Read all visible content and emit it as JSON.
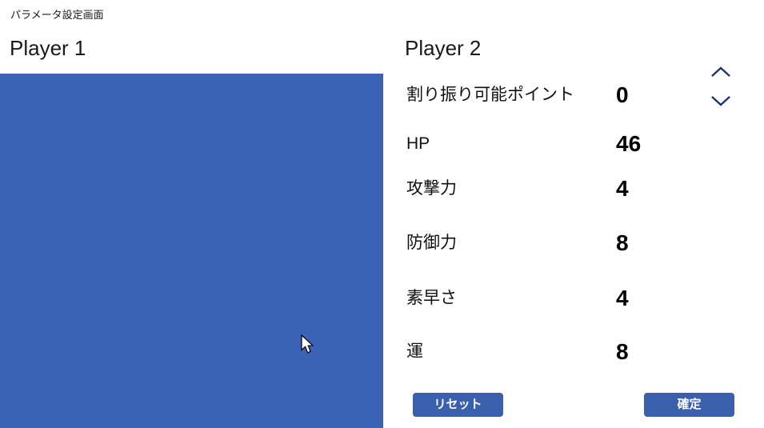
{
  "window": {
    "title": "パラメータ設定画面"
  },
  "player1": {
    "heading": "Player 1",
    "panel_color": "#3a62b5"
  },
  "player2": {
    "heading": "Player 2",
    "stats": [
      {
        "label": "割り振り可能ポイント",
        "value": "0",
        "has_spinner": false
      },
      {
        "label": "HP",
        "value": "46",
        "has_spinner": false
      },
      {
        "label": "攻撃力",
        "value": "4",
        "has_spinner": true
      },
      {
        "label": "防御力",
        "value": "8",
        "has_spinner": true
      },
      {
        "label": "素早さ",
        "value": "4",
        "has_spinner": true
      },
      {
        "label": "運",
        "value": "8",
        "has_spinner": true
      }
    ]
  },
  "buttons": {
    "reset_label": "リセット",
    "confirm_label": "確定",
    "color": "#3a5fad",
    "text_color": "#ffffff"
  },
  "icons": {
    "chevron_up": "chevron-up-icon",
    "chevron_down": "chevron-down-icon",
    "chevron_color": "#1a2f7a",
    "cursor": "mouse-pointer-icon"
  }
}
